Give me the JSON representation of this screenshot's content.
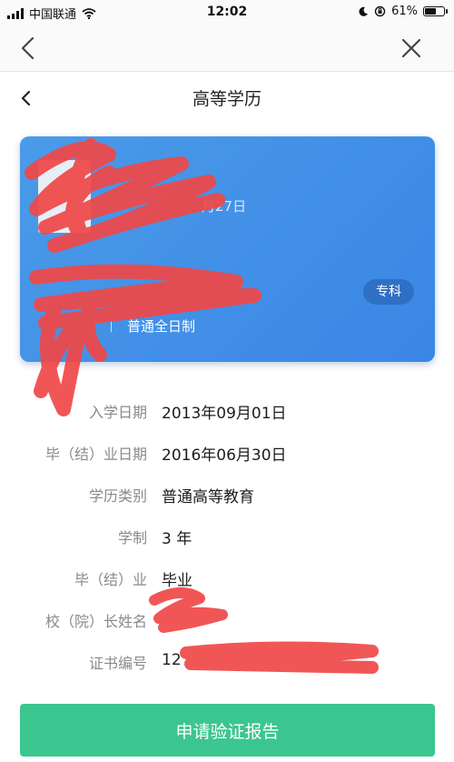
{
  "status_bar": {
    "carrier": "中国联通",
    "time": "12:02",
    "battery_percent": "61%",
    "battery_level": 0.61
  },
  "header": {
    "title": "高等学历"
  },
  "card": {
    "date_fragment": "月27日",
    "study_mode": "普通全日制",
    "level_badge": "专科",
    "card_color": "#3a86e6"
  },
  "details": [
    {
      "label": "入学日期",
      "value": "2013年09月01日"
    },
    {
      "label": "毕（结）业日期",
      "value": "2016年06月30日"
    },
    {
      "label": "学历类别",
      "value": "普通高等教育"
    },
    {
      "label": "学制",
      "value": "3 年"
    },
    {
      "label": "毕（结）业",
      "value": "毕业"
    },
    {
      "label": "校（院）长姓名",
      "value": ""
    },
    {
      "label": "证书编号",
      "value": "12"
    }
  ],
  "actions": {
    "apply_label": "申请验证报告",
    "apply_color": "#3cc68f"
  },
  "icons": [
    "signal-icon",
    "wifi-icon",
    "moon-icon",
    "orientation-lock-icon",
    "battery-icon",
    "back-icon",
    "close-icon",
    "back-small-icon"
  ]
}
